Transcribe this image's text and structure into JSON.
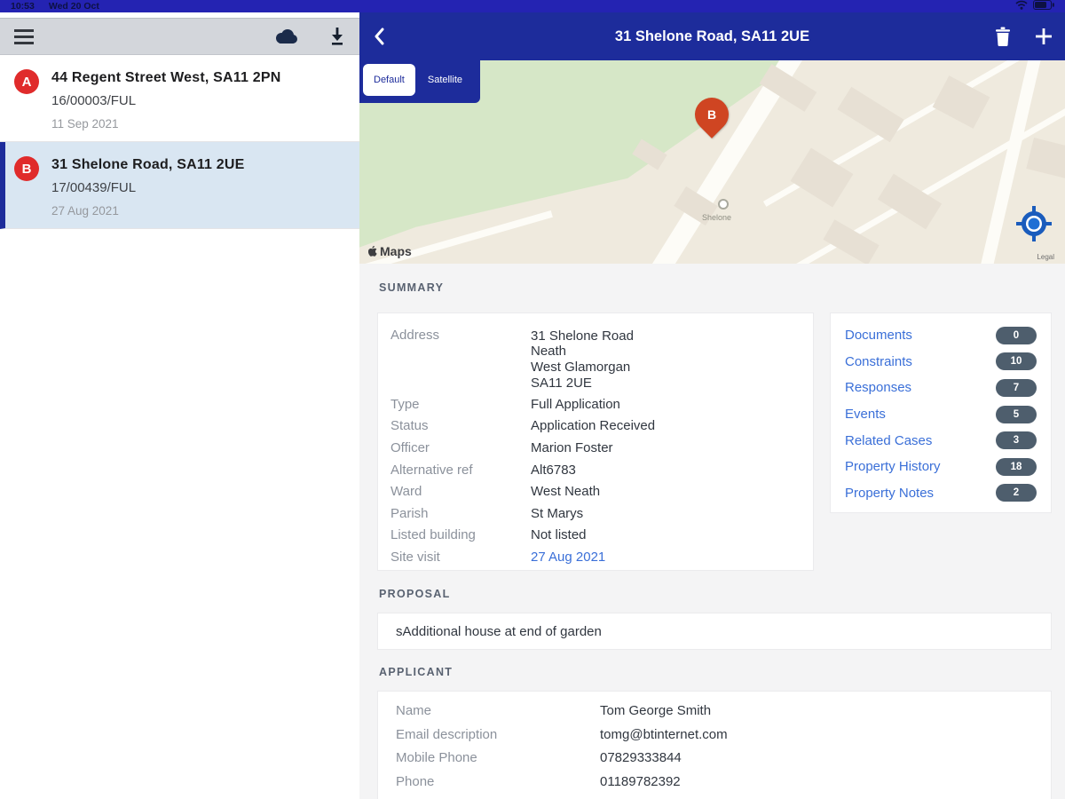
{
  "status_bar": {
    "time": "10:53",
    "date": "Wed 20 Oct"
  },
  "sidebar": {
    "items": [
      {
        "badge": "A",
        "title": "44 Regent Street West, SA11 2PN",
        "reference": "16/00003/FUL",
        "date": "11 Sep 2021",
        "selected": false
      },
      {
        "badge": "B",
        "title": "31 Shelone Road, SA11 2UE",
        "reference": "17/00439/FUL",
        "date": "27 Aug 2021",
        "selected": true
      }
    ]
  },
  "nav": {
    "title": "31 Shelone Road, SA11 2UE"
  },
  "map": {
    "tabs": [
      {
        "label": "Default",
        "selected": true
      },
      {
        "label": "Satellite",
        "selected": false
      }
    ],
    "pin_label": "B",
    "street_label": "Shelone",
    "attribution": "Maps",
    "legal_label": "Legal"
  },
  "summary": {
    "heading": "SUMMARY",
    "fields": [
      {
        "label": "Address",
        "value": [
          "31 Shelone Road",
          "Neath",
          "West Glamorgan",
          "SA11 2UE"
        ]
      },
      {
        "label": "Type",
        "value": "Full Application"
      },
      {
        "label": "Status",
        "value": "Application Received"
      },
      {
        "label": "Officer",
        "value": "Marion Foster"
      },
      {
        "label": "Alternative ref",
        "value": "Alt6783"
      },
      {
        "label": "Ward",
        "value": "West Neath"
      },
      {
        "label": "Parish",
        "value": "St Marys"
      },
      {
        "label": "Listed building",
        "value": "Not listed"
      },
      {
        "label": "Site visit",
        "value": "27 Aug 2021",
        "link": true
      }
    ],
    "links": [
      {
        "label": "Documents",
        "count": "0"
      },
      {
        "label": "Constraints",
        "count": "10"
      },
      {
        "label": "Responses",
        "count": "7"
      },
      {
        "label": "Events",
        "count": "5"
      },
      {
        "label": "Related Cases",
        "count": "3"
      },
      {
        "label": "Property History",
        "count": "18"
      },
      {
        "label": "Property Notes",
        "count": "2"
      }
    ]
  },
  "proposal": {
    "heading": "PROPOSAL",
    "text": "sAdditional house at end of garden"
  },
  "applicant": {
    "heading": "APPLICANT",
    "fields": [
      {
        "label": "Name",
        "value": "Tom George Smith"
      },
      {
        "label": "Email description",
        "value": "tomg@btinternet.com"
      },
      {
        "label": "Mobile Phone",
        "value": "07829333844"
      },
      {
        "label": "Phone",
        "value": "01189782392"
      }
    ]
  },
  "colors": {
    "accent_blue": "#1d2c9b",
    "status_bar_blue": "#2423b2",
    "link_blue": "#3a6fd8",
    "badge_red": "#e02b2b",
    "pill_gray": "#4e5e6d",
    "pin_red": "#cf4522",
    "map_green": "#d6e7c7"
  }
}
